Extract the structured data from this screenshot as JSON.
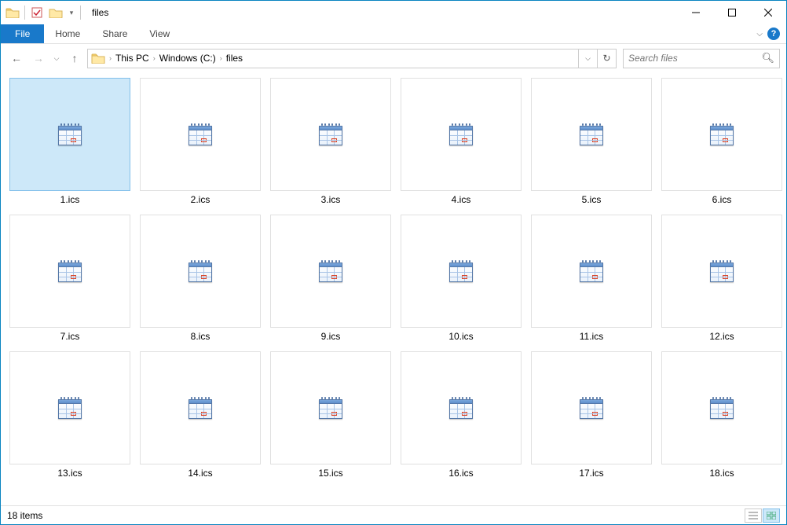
{
  "window": {
    "title": "files"
  },
  "ribbon": {
    "file_label": "File",
    "tabs": [
      "Home",
      "Share",
      "View"
    ]
  },
  "breadcrumbs": [
    "This PC",
    "Windows (C:)",
    "files"
  ],
  "search": {
    "placeholder": "Search files"
  },
  "files": [
    {
      "name": "1.ics",
      "selected": true
    },
    {
      "name": "2.ics"
    },
    {
      "name": "3.ics"
    },
    {
      "name": "4.ics"
    },
    {
      "name": "5.ics"
    },
    {
      "name": "6.ics"
    },
    {
      "name": "7.ics"
    },
    {
      "name": "8.ics"
    },
    {
      "name": "9.ics"
    },
    {
      "name": "10.ics"
    },
    {
      "name": "11.ics"
    },
    {
      "name": "12.ics"
    },
    {
      "name": "13.ics"
    },
    {
      "name": "14.ics"
    },
    {
      "name": "15.ics"
    },
    {
      "name": "16.ics"
    },
    {
      "name": "17.ics"
    },
    {
      "name": "18.ics"
    }
  ],
  "status": {
    "count_label": "18 items"
  }
}
